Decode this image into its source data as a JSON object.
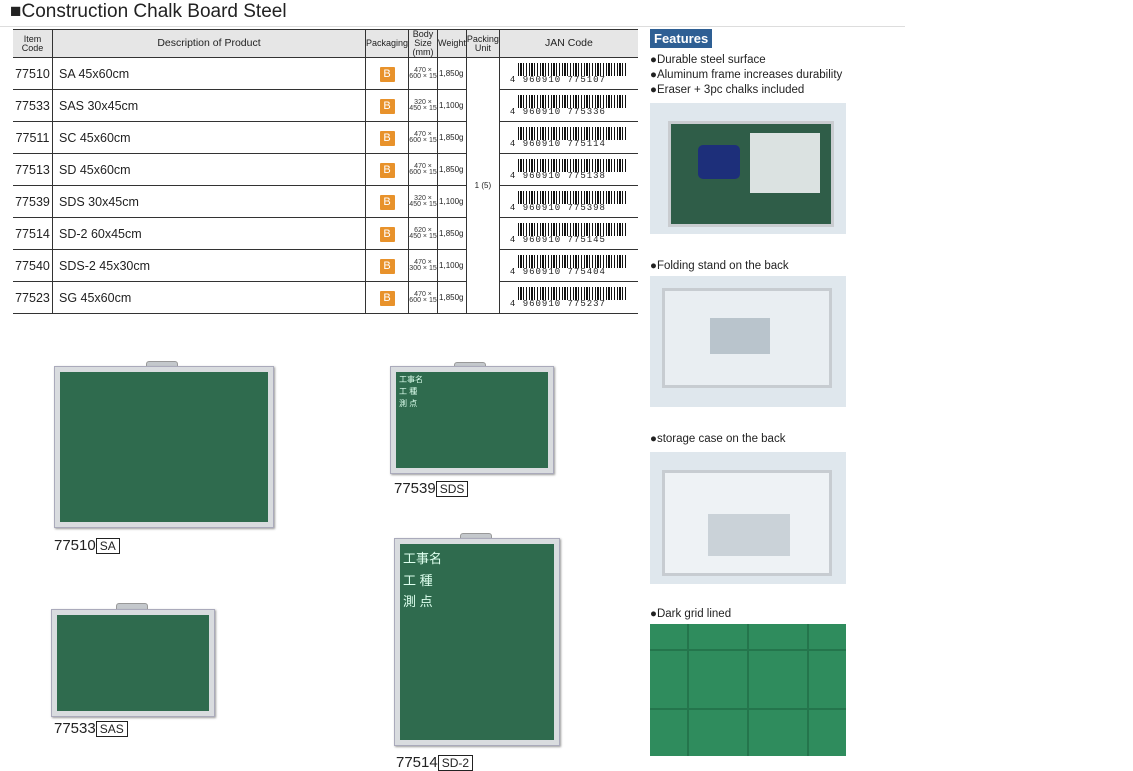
{
  "title": "■Construction Chalk Board Steel",
  "table": {
    "headers": {
      "item_code": "Item Code",
      "description": "Description of Product",
      "packaging": "Packaging",
      "body_size": "Body Size (mm)",
      "weight": "Weight",
      "packing_unit": "Packing Unit",
      "jan": "JAN Code"
    },
    "packing_unit_value": "1 (5)",
    "rows": [
      {
        "code": "77510",
        "desc": "SA 45x60cm",
        "pack": "B",
        "size": "470 × 600 × 15",
        "weight": "1,850g",
        "jan": "4 960910 775107"
      },
      {
        "code": "77533",
        "desc": "SAS 30x45cm",
        "pack": "B",
        "size": "320 × 450 × 15",
        "weight": "1,100g",
        "jan": "4 960910 775336"
      },
      {
        "code": "77511",
        "desc": "SC 45x60cm",
        "pack": "B",
        "size": "470 × 600 × 15",
        "weight": "1,850g",
        "jan": "4 960910 775114"
      },
      {
        "code": "77513",
        "desc": "SD 45x60cm",
        "pack": "B",
        "size": "470 × 600 × 15",
        "weight": "1,850g",
        "jan": "4 960910 775138"
      },
      {
        "code": "77539",
        "desc": "SDS 30x45cm",
        "pack": "B",
        "size": "320 × 450 × 15",
        "weight": "1,100g",
        "jan": "4 960910 775398"
      },
      {
        "code": "77514",
        "desc": "SD-2 60x45cm",
        "pack": "B",
        "size": "620 × 450 × 15",
        "weight": "1,850g",
        "jan": "4 960910 775145"
      },
      {
        "code": "77540",
        "desc": "SDS-2 45x30cm",
        "pack": "B",
        "size": "470 × 300 × 15",
        "weight": "1,100g",
        "jan": "4 960910 775404"
      },
      {
        "code": "77523",
        "desc": "SG 45x60cm",
        "pack": "B",
        "size": "470 × 600 × 15",
        "weight": "1,850g",
        "jan": "4 960910 775237"
      }
    ]
  },
  "features": {
    "tag": "Features",
    "items": [
      "●Durable steel surface",
      "●Aluminum frame increases durability",
      "●Eraser + 3pc chalks included"
    ],
    "folding": "●Folding stand on the back",
    "storage": "●storage case on the back",
    "grid": "●Dark grid lined"
  },
  "products": [
    {
      "code": "77510",
      "model": "SA"
    },
    {
      "code": "77539",
      "model": "SDS"
    },
    {
      "code": "77533",
      "model": "SAS"
    },
    {
      "code": "77514",
      "model": "SD-2"
    }
  ],
  "board_labels": {
    "line1": "工事名",
    "line2": "工 種",
    "line3": "測 点"
  },
  "colors": {
    "accent": "#2e5f94",
    "badge": "#e8922b",
    "board": "#2f6b4e"
  }
}
